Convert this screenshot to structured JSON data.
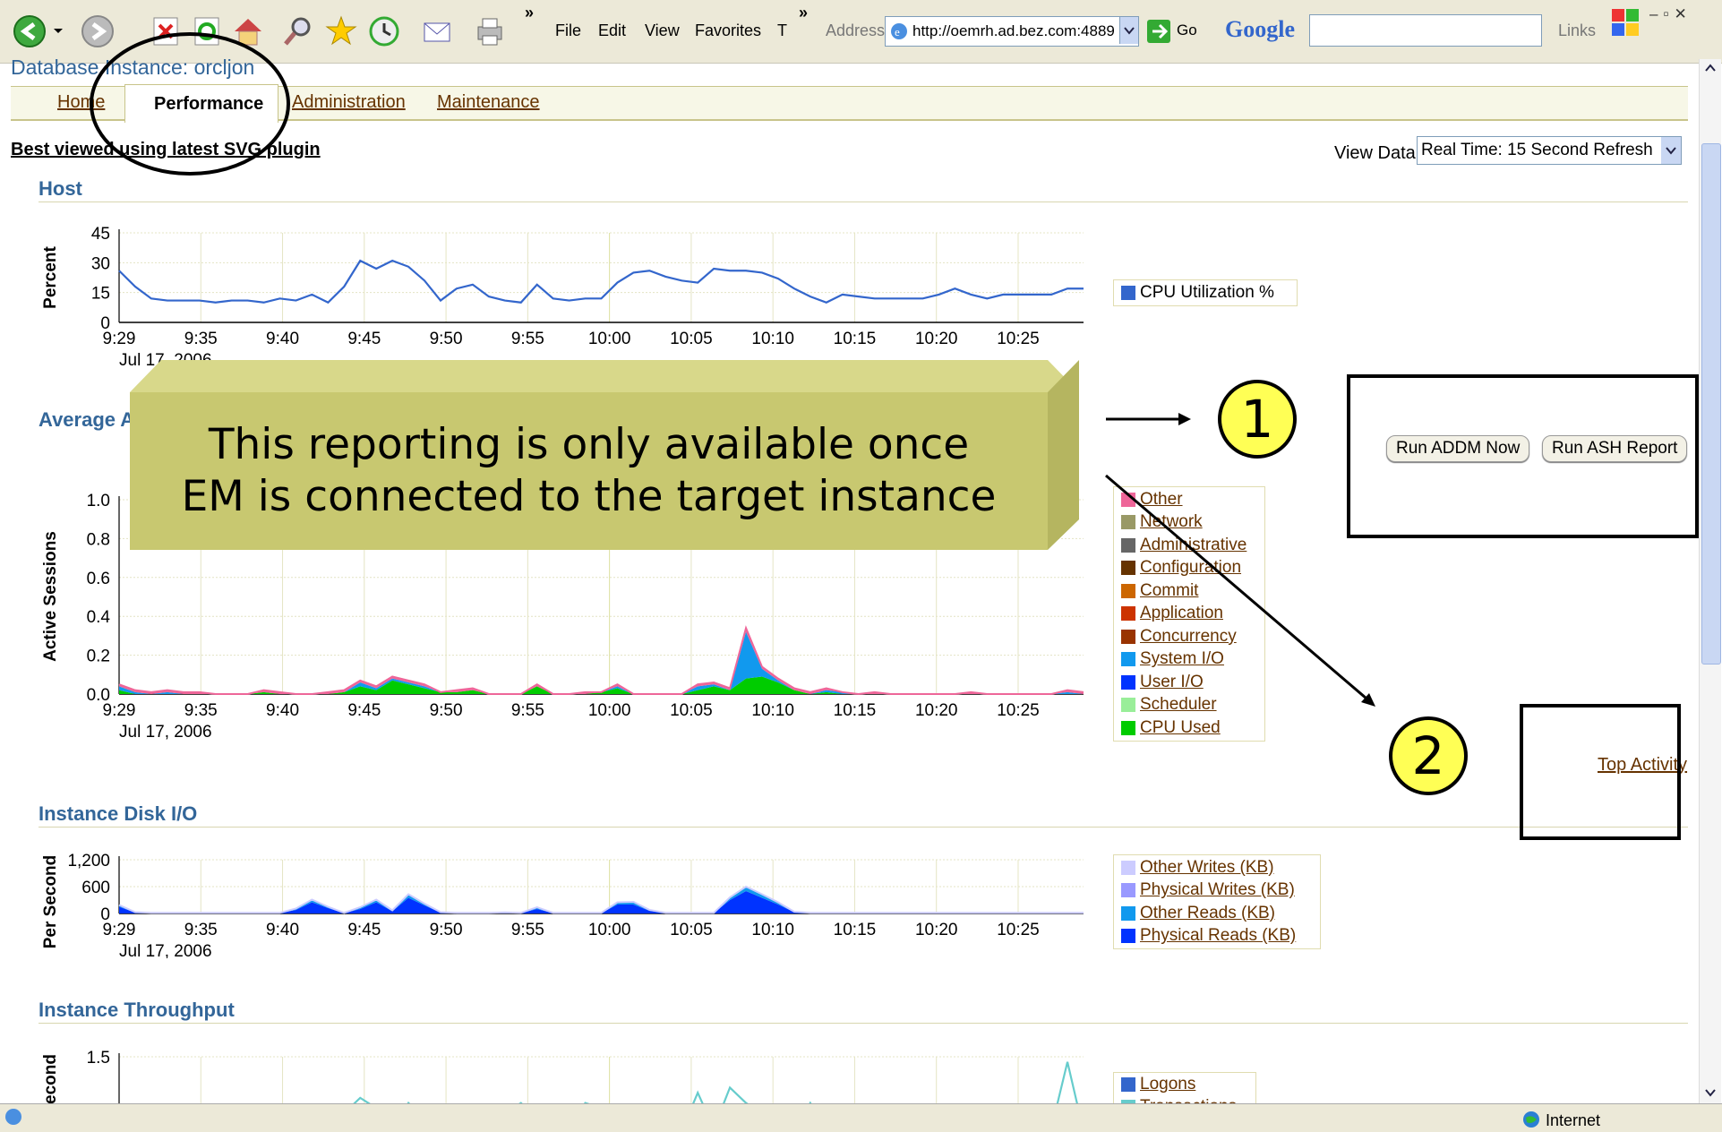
{
  "browser": {
    "menus": [
      "File",
      "Edit",
      "View",
      "Favorites",
      "T"
    ],
    "chevron": "»",
    "address_label": "Address",
    "url": "http://oemrh.ad.bez.com:4889",
    "go_label": "Go",
    "google_label": "Google",
    "links_label": "Links"
  },
  "page": {
    "title": "Database Instance: orcljon",
    "tabs": {
      "home": "Home",
      "performance": "Performance",
      "administration": "Administration",
      "maintenance": "Maintenance"
    },
    "svg_note": "Best viewed using latest SVG plugin",
    "view_data_label": "View Data",
    "view_data_value": "Real Time: 15 Second Refresh"
  },
  "sections": {
    "host": "Host",
    "average": "Average A",
    "disk_io": "Instance Disk I/O",
    "throughput": "Instance Throughput"
  },
  "buttons": {
    "run_addm": "Run ADDM Now",
    "run_ash": "Run ASH Report"
  },
  "top_activity": "Top Activity",
  "callout": {
    "line1": "This reporting is only available once",
    "line2": "EM is connected to the target instance"
  },
  "markers": {
    "one": "1",
    "two": "2"
  },
  "status": {
    "internet": "Internet"
  },
  "colors": {
    "accent": "#336699",
    "link": "#663300",
    "callout": "#c8c870"
  },
  "legends": {
    "host": [
      {
        "label": "CPU Utilization %",
        "color": "#3366cc"
      }
    ],
    "average": [
      {
        "label": "Other",
        "color": "#ee6699"
      },
      {
        "label": "Network",
        "color": "#999966"
      },
      {
        "label": "Administrative",
        "color": "#666666"
      },
      {
        "label": "Configuration",
        "color": "#663300"
      },
      {
        "label": "Commit",
        "color": "#cc6600"
      },
      {
        "label": "Application",
        "color": "#cc3300"
      },
      {
        "label": "Concurrency",
        "color": "#993300"
      },
      {
        "label": "System I/O",
        "color": "#1199ee"
      },
      {
        "label": "User I/O",
        "color": "#0033ff"
      },
      {
        "label": "Scheduler",
        "color": "#99ee99"
      },
      {
        "label": "CPU Used",
        "color": "#00cc00"
      }
    ],
    "disk": [
      {
        "label": "Other Writes (KB)",
        "color": "#ccccff"
      },
      {
        "label": "Physical Writes (KB)",
        "color": "#9999ff"
      },
      {
        "label": "Other Reads (KB)",
        "color": "#1199ee"
      },
      {
        "label": "Physical Reads (KB)",
        "color": "#0033ff"
      }
    ],
    "throughput": [
      {
        "label": "Logons",
        "color": "#3366cc"
      },
      {
        "label": "Transactions",
        "color": "#66cccc"
      }
    ]
  },
  "chart_data": [
    {
      "type": "line",
      "ylabel": "Percent",
      "ylim": [
        0,
        45
      ],
      "yticks": [
        "0",
        "15",
        "30",
        "45"
      ],
      "x_ticks": [
        "9:29",
        "9:35",
        "9:40",
        "9:45",
        "9:50",
        "9:55",
        "10:00",
        "10:05",
        "10:10",
        "10:15",
        "10:20",
        "10:25"
      ],
      "date_label": "Jul 17, 2006",
      "series": [
        {
          "name": "CPU Utilization %",
          "values": [
            26,
            18,
            12,
            11,
            11,
            11,
            10,
            11,
            11,
            10,
            12,
            11,
            14,
            10,
            18,
            31,
            27,
            31,
            28,
            21,
            11,
            17,
            19,
            13,
            11,
            10,
            19,
            12,
            11,
            12,
            12,
            20,
            25,
            26,
            23,
            21,
            20,
            27,
            26,
            26,
            25,
            22,
            17,
            13,
            10,
            14,
            13,
            12,
            12,
            12,
            12,
            14,
            17,
            14,
            12,
            14,
            14,
            14,
            14,
            17,
            17
          ]
        }
      ]
    },
    {
      "type": "area",
      "ylabel": "Active Sessions",
      "ylim": [
        0,
        1.0
      ],
      "yticks": [
        "0.0",
        "0.2",
        "0.4",
        "0.6",
        "0.8",
        "1.0"
      ],
      "x_ticks": [
        "9:29",
        "9:35",
        "9:40",
        "9:45",
        "9:50",
        "9:55",
        "10:00",
        "10:05",
        "10:10",
        "10:15",
        "10:20",
        "10:25"
      ],
      "date_label": "Jul 17, 2006",
      "series": [
        {
          "name": "CPU Used",
          "values": [
            0.02,
            0,
            0,
            0,
            0,
            0,
            0,
            0,
            0,
            0.01,
            0,
            0,
            0,
            0,
            0.01,
            0.04,
            0.02,
            0.07,
            0.05,
            0.03,
            0.01,
            0.01,
            0.02,
            0,
            0,
            0,
            0.04,
            0,
            0,
            0,
            0.01,
            0.03,
            0,
            0,
            0,
            0,
            0.02,
            0.04,
            0.02,
            0.08,
            0.09,
            0.06,
            0.02,
            0,
            0.01,
            0,
            0,
            0,
            0,
            0,
            0,
            0,
            0,
            0,
            0,
            0,
            0,
            0,
            0,
            0,
            0
          ]
        },
        {
          "name": "System I/O",
          "values": [
            0.02,
            0.01,
            0,
            0.01,
            0,
            0,
            0,
            0,
            0,
            0,
            0,
            0,
            0,
            0,
            0,
            0.02,
            0.01,
            0.01,
            0.01,
            0.01,
            0,
            0,
            0,
            0,
            0,
            0,
            0,
            0,
            0,
            0,
            0,
            0.01,
            0,
            0,
            0,
            0,
            0.02,
            0.01,
            0,
            0.24,
            0.04,
            0.01,
            0,
            0,
            0.01,
            0.01,
            0,
            0,
            0,
            0,
            0,
            0,
            0,
            0,
            0,
            0,
            0,
            0,
            0,
            0.01,
            0
          ]
        },
        {
          "name": "Other",
          "values": [
            0.01,
            0.01,
            0.01,
            0.01,
            0.01,
            0.01,
            0,
            0,
            0,
            0.01,
            0.01,
            0,
            0,
            0.01,
            0.01,
            0.01,
            0.01,
            0.01,
            0.01,
            0.01,
            0,
            0.01,
            0.01,
            0,
            0,
            0,
            0.01,
            0,
            0,
            0.01,
            0,
            0.01,
            0,
            0,
            0,
            0,
            0.01,
            0.01,
            0.01,
            0.02,
            0.01,
            0.01,
            0.01,
            0.01,
            0.01,
            0,
            0,
            0.01,
            0,
            0,
            0,
            0,
            0,
            0.01,
            0,
            0,
            0,
            0,
            0,
            0.01,
            0.01
          ]
        }
      ]
    },
    {
      "type": "area",
      "ylabel": "Per Second",
      "ylim": [
        0,
        1200
      ],
      "yticks": [
        "0",
        "600",
        "1,200"
      ],
      "x_ticks": [
        "9:29",
        "9:35",
        "9:40",
        "9:45",
        "9:50",
        "9:55",
        "10:00",
        "10:05",
        "10:10",
        "10:15",
        "10:20",
        "10:25"
      ],
      "date_label": "Jul 17, 2006",
      "series": [
        {
          "name": "Physical Reads (KB)",
          "values": [
            150,
            20,
            10,
            10,
            10,
            10,
            10,
            10,
            10,
            10,
            10,
            80,
            250,
            120,
            10,
            100,
            250,
            50,
            350,
            180,
            20,
            10,
            10,
            10,
            20,
            10,
            100,
            10,
            10,
            10,
            10,
            200,
            200,
            60,
            10,
            10,
            10,
            10,
            300,
            500,
            350,
            200,
            30,
            10,
            10,
            10,
            10,
            10,
            10,
            10,
            10,
            10,
            10,
            10,
            10,
            10,
            10,
            10,
            10,
            10,
            10
          ]
        },
        {
          "name": "Other Reads (KB)",
          "values": [
            40,
            10,
            5,
            5,
            5,
            5,
            5,
            5,
            5,
            5,
            5,
            30,
            60,
            30,
            5,
            40,
            60,
            20,
            80,
            40,
            10,
            5,
            5,
            5,
            5,
            5,
            40,
            5,
            5,
            5,
            5,
            50,
            60,
            20,
            5,
            5,
            5,
            5,
            60,
            100,
            80,
            50,
            10,
            5,
            5,
            5,
            5,
            5,
            5,
            5,
            5,
            5,
            5,
            5,
            5,
            5,
            5,
            5,
            5,
            5,
            5
          ]
        }
      ]
    },
    {
      "type": "line",
      "ylabel": "econd",
      "ylim": [
        0,
        1.5
      ],
      "yticks": [
        "1.5"
      ],
      "series": [
        {
          "name": "Transactions",
          "values": [
            0.1,
            0.05,
            0.1,
            0.05,
            0.5,
            0.05,
            0.4,
            0.05,
            0.1,
            0.05,
            0.4,
            0.05,
            0.5,
            0.05,
            0.4,
            0.7,
            0.5,
            0.1,
            0.6,
            0.3,
            0.05,
            0.2,
            0.1,
            0.05,
            0.4,
            0.6,
            0.3,
            0.05,
            0.1,
            0.6,
            0.5,
            0.1,
            0.05,
            0.3,
            0.1,
            0.05,
            0.8,
            0.1,
            0.9,
            0.6,
            0.4,
            0.1,
            0.05,
            0.6,
            0.1,
            0.05,
            0.4,
            0.1,
            0.05,
            0.5,
            0.1,
            0.05,
            0.4,
            0.05,
            0.1,
            0.05,
            0.1,
            0.05,
            0.1,
            1.4,
            0.05
          ]
        }
      ]
    }
  ]
}
